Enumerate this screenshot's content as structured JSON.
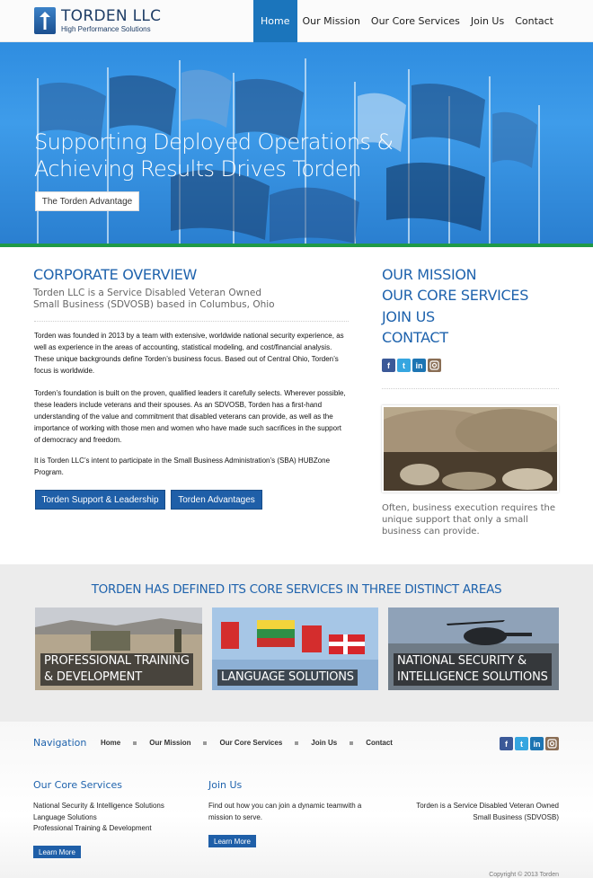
{
  "brand": {
    "name": "TORDEN LLC",
    "tagline": "High Performance Solutions"
  },
  "nav": [
    "Home",
    "Our Mission",
    "Our Core Services",
    "Join Us",
    "Contact"
  ],
  "hero": {
    "title_line1": "Supporting Deployed Operations &",
    "title_line2": "Achieving Results Drives Torden",
    "button": "The Torden Advantage"
  },
  "overview": {
    "heading": "CORPORATE OVERVIEW",
    "subheading": "Torden LLC is a Service Disabled Veteran Owned Small Business (SDVOSB) based in Columbus, Ohio",
    "p1": "Torden was founded in 2013 by a team with extensive, worldwide national security experience, as well as experience in the areas of accounting, statistical modeling, and cost/financial analysis. These unique backgrounds define Torden’s business focus. Based out of Central Ohio, Torden’s focus is worldwide.",
    "p2": "Torden’s foundation is built on the proven, qualified leaders it carefully selects. Wherever possible, these leaders include veterans and their spouses. As an SDVOSB, Torden has a first-hand understanding of the value and commitment that disabled veterans can provide, as well as the importance of working with those men and women who have made such sacrifices in the support of democracy and freedom.",
    "p3": "It is Torden LLC’s intent to participate in the Small Business Administration’s (SBA) HUBZone Program.",
    "btn_support": "Torden Support & Leadership",
    "btn_advantages": "Torden Advantages"
  },
  "sidebar": {
    "links": [
      "OUR MISSION",
      "OUR CORE SERVICES",
      "JOIN US",
      "CONTACT"
    ],
    "caption": "Often, business execution requires the unique support that only a small business can provide."
  },
  "social": [
    "f",
    "t",
    "in",
    "ig"
  ],
  "services": {
    "title": "TORDEN HAS DEFINED ITS CORE SERVICES IN THREE DISTINCT AREAS",
    "tiles": [
      {
        "line1": "PROFESSIONAL TRAINING",
        "line2": "& DEVELOPMENT"
      },
      {
        "line1": "LANGUAGE SOLUTIONS",
        "line2": ""
      },
      {
        "line1": "NATIONAL SECURITY &",
        "line2": "INTELLIGENCE SOLUTIONS"
      }
    ]
  },
  "footer": {
    "nav_title": "Navigation",
    "nav": [
      "Home",
      "Our Mission",
      "Our Core Services",
      "Join Us",
      "Contact"
    ],
    "core_title": "Our Core Services",
    "core_items": [
      "National Security & Intelligence Solutions",
      "Language Solutions",
      "Professional Training & Development"
    ],
    "core_button": "Learn More",
    "join_title": "Join Us",
    "join_text": "Find out how you can join a dynamic teamwith a mission to serve.",
    "join_button": "Learn More",
    "sdvosb_text": "Torden is a Service Disabled Veteran Owned Small Business (SDVOSB)",
    "copyright": "Copyright © 2013 Torden"
  },
  "colors": {
    "brand_blue": "#1f63ad",
    "nav_active": "#1b75bc",
    "hero_green": "#1f9a47"
  }
}
